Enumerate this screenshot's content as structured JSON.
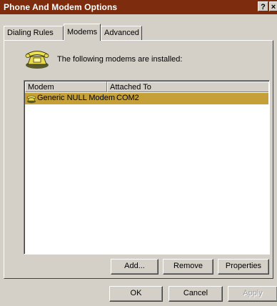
{
  "window": {
    "title": "Phone And Modem Options",
    "help_button": "?",
    "close_button": "×"
  },
  "tabs": [
    {
      "label": "Dialing Rules",
      "selected": false
    },
    {
      "label": "Modems",
      "selected": true
    },
    {
      "label": "Advanced",
      "selected": false
    }
  ],
  "modems_panel": {
    "info_text": "The following modems are  installed:",
    "icon": "telephone-icon",
    "list": {
      "columns": [
        "Modem",
        "Attached To"
      ],
      "rows": [
        {
          "modem": "Generic NULL Modem",
          "attached_to": "COM2",
          "icon": "modem-icon",
          "selected": true
        }
      ]
    },
    "buttons": {
      "add": "Add...",
      "remove": "Remove",
      "properties": "Properties"
    }
  },
  "dialog_buttons": {
    "ok": "OK",
    "cancel": "Cancel",
    "apply": "Apply"
  },
  "colors": {
    "titlebar": "#7d2d0d",
    "selection": "#c5a039",
    "face": "#d4d0c8"
  }
}
